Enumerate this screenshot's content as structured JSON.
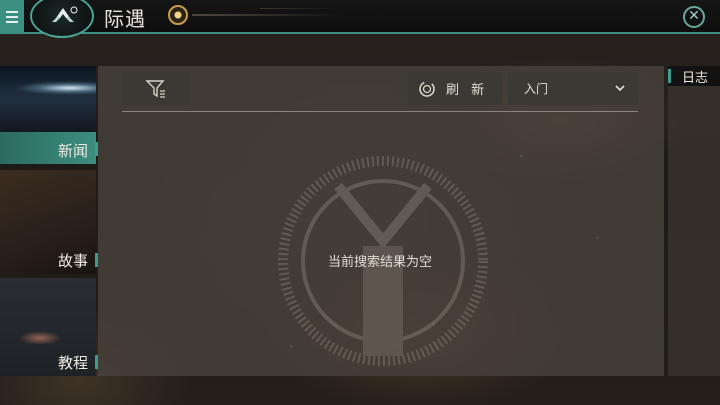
{
  "header": {
    "title": "际遇",
    "menu_icon": "hamburger-icon",
    "logo_icon": "ship-logo-icon",
    "close_icon": "close-icon"
  },
  "sidebar": {
    "items": [
      {
        "label": "新闻",
        "active": true
      },
      {
        "label": "故事",
        "active": false
      },
      {
        "label": "教程",
        "active": false
      }
    ]
  },
  "toolbar": {
    "filter_icon": "filter-icon",
    "refresh_label": "刷 新",
    "refresh_icon": "refresh-icon",
    "dropdown_value": "入门",
    "dropdown_icon": "chevron-down-icon"
  },
  "main": {
    "empty_message": "当前搜索结果为空"
  },
  "log_panel": {
    "label": "日志"
  },
  "colors": {
    "accent": "#3f9c8c",
    "panel": "#48423c",
    "button": "#3c3833"
  }
}
